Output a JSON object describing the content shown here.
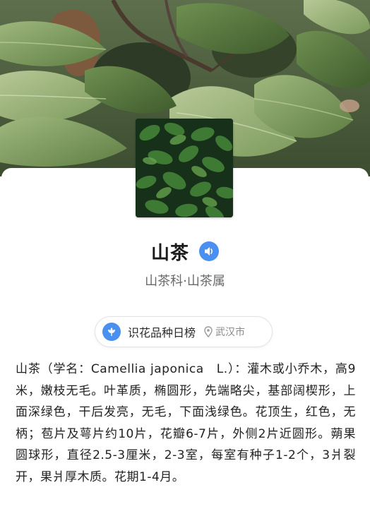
{
  "plant": {
    "name": "山茶",
    "family_genus": "山茶科·山茶属"
  },
  "ranking": {
    "label": "识花品种日榜",
    "location": "武汉市"
  },
  "description": "山茶（学名：Camellia japonica　L.）：灌木或小乔木，高9米，嫩枝无毛。叶革质，椭圆形，先端略尖，基部阔楔形，上面深绿色，干后发亮，无毛，下面浅绿色。花顶生，红色，无柄；苞片及萼片约10片，花瓣6-7片，外侧2片近圆形。蒴果圆球形，直径2.5-3厘米，2-3室，每室有种子1-2个，3爿裂开，果爿厚木质。花期1-4月。",
  "icons": {
    "sound": "speaker-icon",
    "ranking": "flower-badge-icon",
    "location": "location-pin-icon"
  },
  "colors": {
    "accent": "#4a90f0",
    "title": "#1b1b1b",
    "subtitle": "#6a6a6a",
    "body": "#222222"
  }
}
